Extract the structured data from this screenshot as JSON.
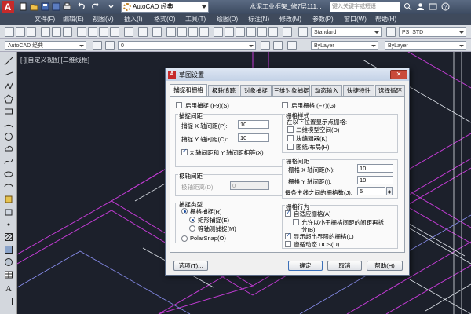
{
  "titlebar": {
    "workspace": "AutoCAD 经典",
    "document_title": "水泥工业框架_修7层111...",
    "search_placeholder": "键入关键字或短语"
  },
  "menu": [
    "文件(F)",
    "编辑(E)",
    "视图(V)",
    "插入(I)",
    "格式(O)",
    "工具(T)",
    "绘图(D)",
    "标注(N)",
    "修改(M)",
    "参数(P)",
    "窗口(W)",
    "帮助(H)"
  ],
  "toolbar": {
    "workspace_select": "AutoCAD 经典",
    "text_style": "Standard",
    "dim_style": "PS_STD",
    "layer_value": "0",
    "linetype1": "ByLayer",
    "linetype2": "ByLayer"
  },
  "viewport_label": "[-][自定义视图][二维线框]",
  "dialog": {
    "title": "草图设置",
    "close_label": "✕",
    "tabs": [
      "捕捉和栅格",
      "极轴追踪",
      "对象捕捉",
      "三维对象捕捉",
      "动态输入",
      "快捷特性",
      "选择循环"
    ],
    "snap_on": "启用捕捉 (F9)(S)",
    "grid_on": "启用栅格 (F7)(G)",
    "snap_spacing_title": "捕捉间距",
    "snap_x_label": "捕捉 X 轴间距(P):",
    "snap_x_value": "10",
    "snap_y_label": "捕捉 Y 轴间距(C):",
    "snap_y_value": "10",
    "equal_xy": "X 轴间距和 Y 轴间距相等(X)",
    "polar_title": "极轴间距",
    "polar_distance_label": "极轴距离(D):",
    "polar_distance_value": "0",
    "snap_type_title": "捕捉类型",
    "grid_snap": "栅格捕捉(R)",
    "rect_snap": "矩形捕捉(E)",
    "iso_snap": "等轴测捕捉(M)",
    "polar_snap": "PolarSnap(O)",
    "grid_style_title": "栅格样式",
    "grid_style_sub": "在以下位置显示点栅格:",
    "grid_model": "二维模型空间(D)",
    "grid_block": "块编辑器(K)",
    "grid_sheet": "图纸/布局(H)",
    "grid_spacing_title": "栅格间距",
    "grid_x_label": "栅格 X 轴间距(N):",
    "grid_x_value": "10",
    "grid_y_label": "栅格 Y 轴间距(I):",
    "grid_y_value": "10",
    "major_every_label": "每条主线之间的栅格数(J):",
    "major_every_value": "5",
    "grid_behavior_title": "栅格行为",
    "adaptive": "自适应栅格(A)",
    "allow_sub_1": "允许以小于栅格间距的间距再拆",
    "allow_sub_2": "分(B)",
    "beyond_limits": "显示超出界限的栅格(L)",
    "follow_ucs": "遵循动态 UCS(U)",
    "options_btn": "选项(T)...",
    "ok_btn": "确定",
    "cancel_btn": "取消",
    "help_btn": "帮助(H)"
  },
  "colors": {
    "annotation_arrow": "#e0242a",
    "drawing_magenta": "#c23bd4",
    "drawing_white": "#dfe3ea"
  }
}
